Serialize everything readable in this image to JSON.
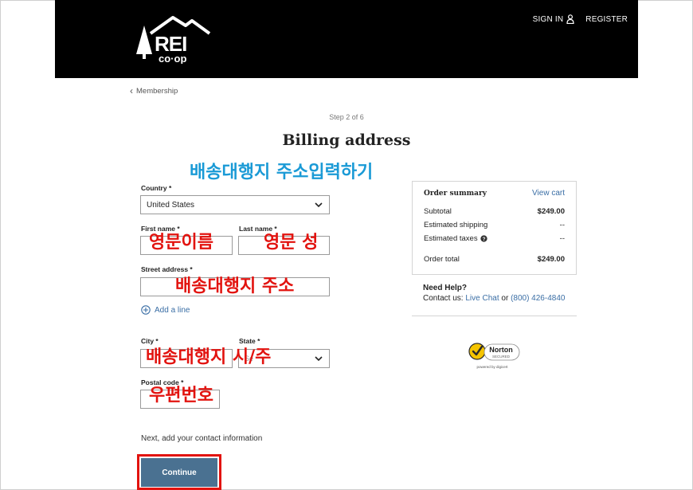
{
  "header": {
    "logo_alt": "REI co-op",
    "sign_in": "SIGN IN",
    "register": "REGISTER"
  },
  "breadcrumb": {
    "label": "Membership"
  },
  "step": "Step 2 of 6",
  "title": "Billing address",
  "annotations": {
    "heading": "배송대행지 주소입력하기",
    "first_name": "영문이름",
    "last_name": "영문 성",
    "street": "배송대행지 주소",
    "city_state": "배송대행지 시/주",
    "postal": "우편번호"
  },
  "form": {
    "country_label": "Country *",
    "country_value": "United States",
    "first_name_label": "First name *",
    "last_name_label": "Last name *",
    "street_label": "Street address *",
    "add_line": "Add a line",
    "city_label": "City *",
    "state_label": "State *",
    "state_placeholder": "Se",
    "postal_label": "Postal code *",
    "next_text": "Next, add your contact information",
    "continue": "Continue"
  },
  "summary": {
    "title": "Order summary",
    "view_cart": "View cart",
    "rows": [
      {
        "name": "Subtotal",
        "value": "$249.00"
      },
      {
        "name": "Estimated shipping",
        "value": "--"
      },
      {
        "name": "Estimated taxes",
        "value": "--"
      },
      {
        "name": "Order total",
        "value": "$249.00"
      }
    ]
  },
  "help": {
    "title": "Need Help?",
    "prefix": "Contact us: ",
    "live_chat": "Live Chat",
    "or": " or ",
    "phone": "(800) 426-4840"
  },
  "norton": {
    "brand": "Norton",
    "secured": "SECURED",
    "powered": "powered by digicert"
  },
  "colors": {
    "header_bg": "#000000",
    "link": "#3a6ea5",
    "button": "#4a7191",
    "annotation_red": "#e2130f",
    "annotation_cyan": "#1a9ad6"
  }
}
